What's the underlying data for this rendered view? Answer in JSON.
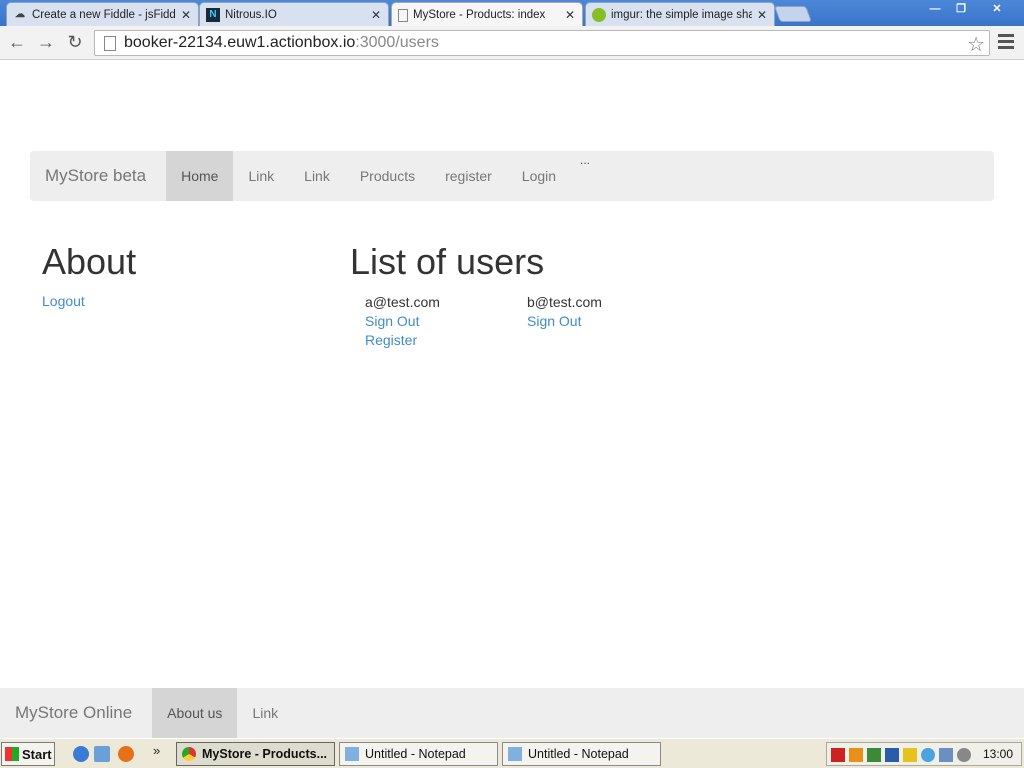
{
  "browser": {
    "tabs": [
      {
        "title": "Create a new Fiddle - jsFiddle"
      },
      {
        "title": "Nitrous.IO"
      },
      {
        "title": "MyStore - Products: index"
      },
      {
        "title": "imgur: the simple image sharer"
      }
    ],
    "address": {
      "host": "booker-22134.euw1.actionbox.io",
      "path": ":3000/users"
    }
  },
  "site": {
    "brand": "MyStore beta",
    "nav": [
      "Home",
      "Link",
      "Link",
      "Products",
      "register",
      "Login"
    ],
    "nav_extra": "...",
    "about_heading": "About",
    "logout": "Logout",
    "users_heading": "List of users",
    "users": [
      {
        "email": "a@test.com",
        "links": [
          "Sign Out",
          "Register"
        ]
      },
      {
        "email": "b@test.com",
        "links": [
          "Sign Out"
        ]
      }
    ],
    "footer": {
      "brand": "MyStore Online",
      "items": [
        "About us",
        "Link"
      ]
    }
  },
  "taskbar": {
    "start": "Start",
    "tasks": [
      "MyStore - Products...",
      "Untitled - Notepad",
      "Untitled - Notepad"
    ],
    "clock": "13:00"
  }
}
